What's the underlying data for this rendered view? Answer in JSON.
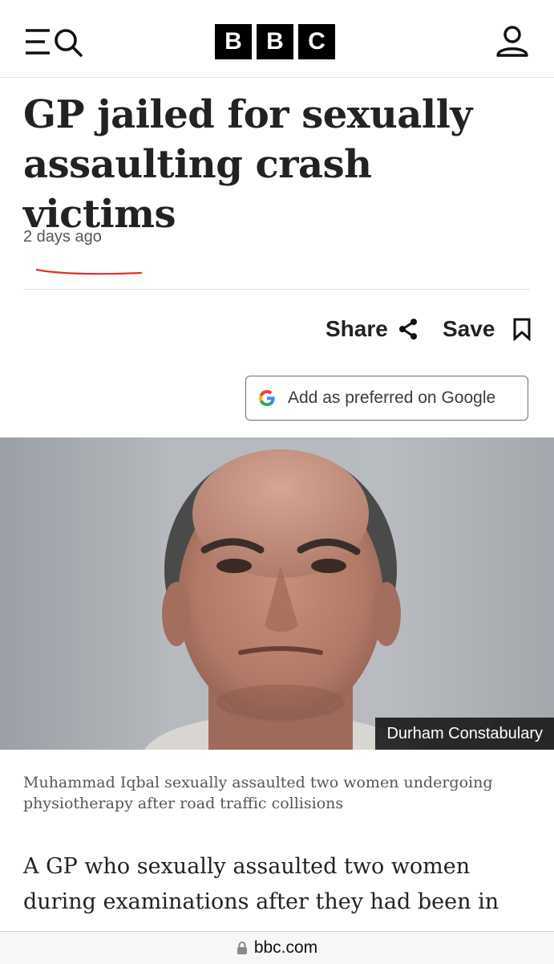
{
  "header": {
    "menu_icon": "menu-icon",
    "search_icon": "search-icon",
    "logo_letters": [
      "B",
      "B",
      "C"
    ],
    "account_icon": "account-icon"
  },
  "article": {
    "headline": "GP jailed for sexually assaulting crash victims",
    "timestamp": "2 days ago",
    "share_label": "Share",
    "save_label": "Save",
    "google_button_label": "Add as preferred on Google",
    "image_credit": "Durham Constabulary",
    "image_caption": "Muhammad Iqbal sexually assaulted two women undergoing physiotherapy after road traffic collisions",
    "body_first_paragraph": "A GP who sexually assaulted two women during examinations after they had been in"
  },
  "browser": {
    "url": "bbc.com"
  },
  "colors": {
    "underline_accent": "#e0312b",
    "text_primary": "#202224",
    "text_secondary": "#545658"
  }
}
